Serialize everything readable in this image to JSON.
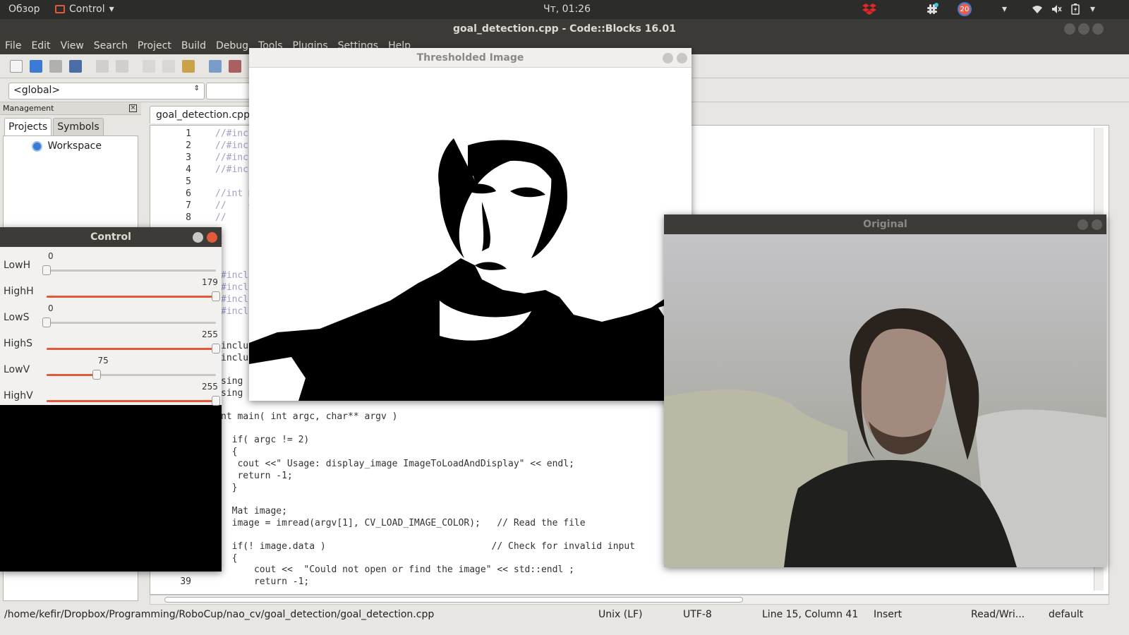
{
  "topbar": {
    "activities": "Обзор",
    "app_menu": "Control",
    "clock": "Чт, 01:26",
    "notification_count": "20"
  },
  "window": {
    "title": "goal_detection.cpp - Code::Blocks 16.01"
  },
  "menu": [
    "File",
    "Edit",
    "View",
    "Search",
    "Project",
    "Build",
    "Debug",
    "Tools",
    "Plugins",
    "Settings",
    "Help"
  ],
  "toolbar": {
    "scope_combo": "<global>"
  },
  "management": {
    "title": "Management",
    "tabs": [
      "Projects",
      "Symbols"
    ],
    "tree_root": "Workspace"
  },
  "editor": {
    "tab_label": "goal_detection.cpp",
    "lines": [
      {
        "n": "1",
        "text": "//#incl",
        "comment": true
      },
      {
        "n": "2",
        "text": "//#incl",
        "comment": true
      },
      {
        "n": "3",
        "text": "//#incl",
        "comment": true
      },
      {
        "n": "4",
        "text": "//#incl",
        "comment": true
      },
      {
        "n": "5",
        "text": "",
        "comment": false
      },
      {
        "n": "6",
        "text": "//int m",
        "comment": true
      },
      {
        "n": "7",
        "text": "//    <",
        "comment": true
      },
      {
        "n": "8",
        "text": "//    p",
        "comment": true
      },
      {
        "n": "",
        "text": "#incl",
        "comment": true
      },
      {
        "n": "",
        "text": "#incl",
        "comment": true
      },
      {
        "n": "",
        "text": "#incl",
        "comment": true
      },
      {
        "n": "",
        "text": "#incl",
        "comment": true
      },
      {
        "n": "",
        "text": "inclu",
        "comment": false
      },
      {
        "n": "",
        "text": "inclu",
        "comment": false
      },
      {
        "n": "",
        "text": "sing n",
        "comment": false
      },
      {
        "n": "",
        "text": "sing n",
        "comment": false
      },
      {
        "n": "",
        "text": "nt main( int argc, char** argv )",
        "comment": false
      },
      {
        "n": "",
        "text": "  if( argc != 2)",
        "comment": false
      },
      {
        "n": "",
        "text": "  {",
        "comment": false
      },
      {
        "n": "",
        "text": "   cout <<\" Usage: display_image ImageToLoadAndDisplay\" << endl;",
        "comment": false
      },
      {
        "n": "",
        "text": "   return -1;",
        "comment": false
      },
      {
        "n": "",
        "text": "  }",
        "comment": false
      },
      {
        "n": "",
        "text": "  Mat image;",
        "comment": false
      },
      {
        "n": "",
        "text": "  image = imread(argv[1], CV_LOAD_IMAGE_COLOR);   // Read the file",
        "comment": false
      },
      {
        "n": "",
        "text": "  if(! image.data )                              // Check for invalid input",
        "comment": false
      },
      {
        "n": "",
        "text": "  {",
        "comment": false
      },
      {
        "n": "",
        "text": "      cout <<  \"Could not open or find the image\" << std::endl ;",
        "comment": false
      },
      {
        "n": "39",
        "text": "      return -1;",
        "comment": false
      }
    ]
  },
  "status": {
    "path": "/home/kefir/Dropbox/Programming/RoboCup/nao_cv/goal_detection/goal_detection.cpp",
    "eol": "Unix (LF)",
    "encoding": "UTF-8",
    "position": "Line 15, Column 41",
    "mode": "Insert",
    "access": "Read/Wri...",
    "profile": "default"
  },
  "thresholded": {
    "title": "Thresholded Image"
  },
  "original": {
    "title": "Original"
  },
  "control": {
    "title": "Control",
    "sliders": [
      {
        "label": "LowH",
        "value": "0",
        "fraction": 0.0,
        "filled": false
      },
      {
        "label": "HighH",
        "value": "179",
        "fraction": 1.0,
        "filled": true
      },
      {
        "label": "LowS",
        "value": "0",
        "fraction": 0.0,
        "filled": false
      },
      {
        "label": "HighS",
        "value": "255",
        "fraction": 1.0,
        "filled": true
      },
      {
        "label": "LowV",
        "value": "75",
        "fraction": 0.294,
        "filled": true
      },
      {
        "label": "HighV",
        "value": "255",
        "fraction": 1.0,
        "filled": true
      }
    ]
  }
}
